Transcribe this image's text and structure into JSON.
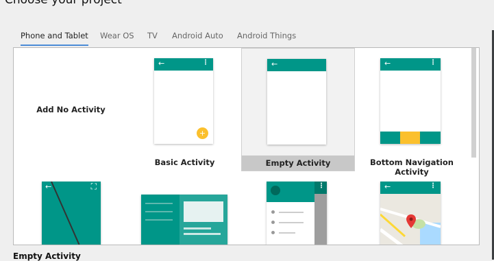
{
  "page": {
    "title": "Choose your project"
  },
  "tabs": [
    {
      "label": "Phone and Tablet",
      "active": true
    },
    {
      "label": "Wear OS"
    },
    {
      "label": "TV"
    },
    {
      "label": "Android Auto"
    },
    {
      "label": "Android Things"
    }
  ],
  "templates": [
    {
      "label": "Add No Activity"
    },
    {
      "label": "Basic Activity"
    },
    {
      "label": "Empty Activity",
      "selected": true
    },
    {
      "label": "Bottom Navigation Activity"
    }
  ],
  "icons": {
    "back": "←",
    "overflow": "⋮",
    "add": "+",
    "fullscreen": "⛶"
  },
  "colors": {
    "primary": "#009688",
    "accent": "#fbc02d",
    "selection": "#c8c8c8"
  },
  "selection_footer": {
    "title": "Empty Activity"
  }
}
